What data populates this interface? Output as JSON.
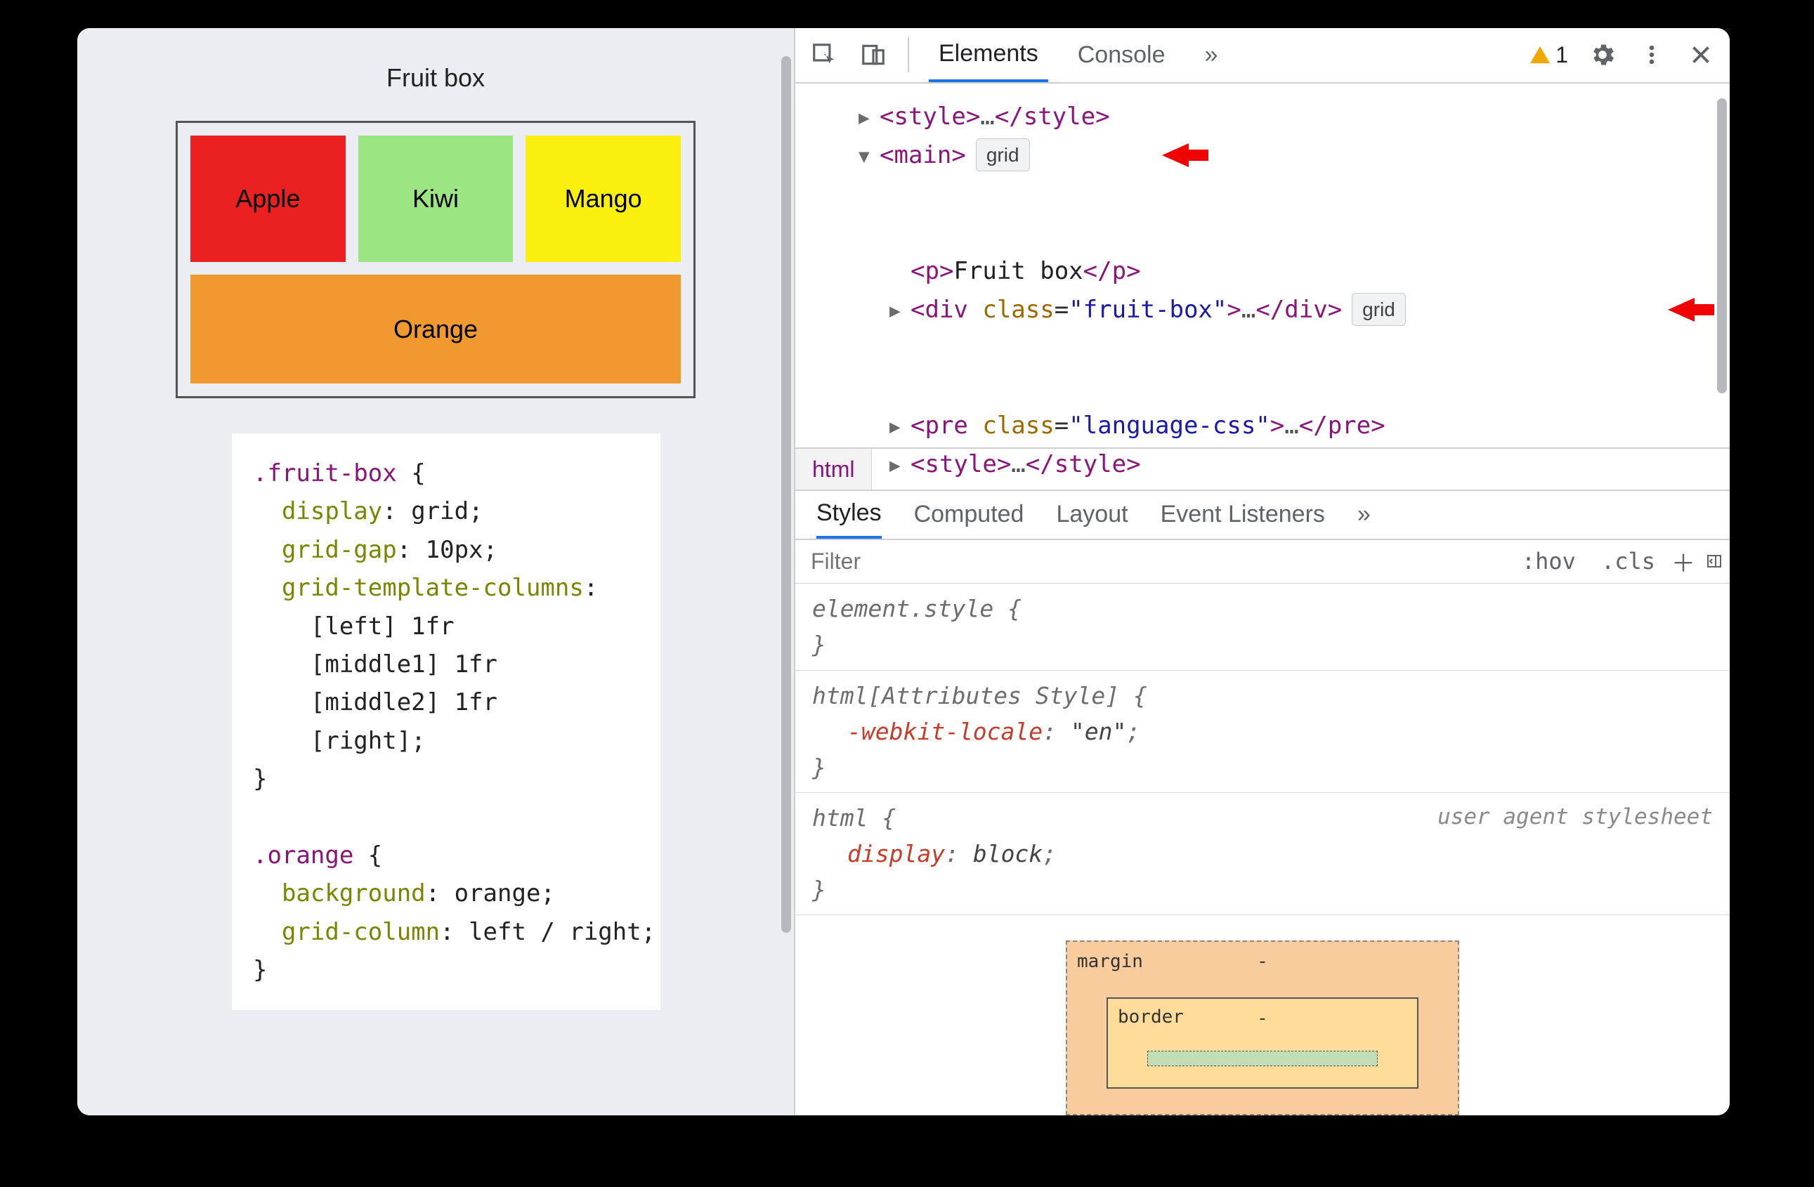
{
  "left": {
    "title": "Fruit box",
    "fruits": {
      "a": "Apple",
      "b": "Kiwi",
      "c": "Mango",
      "d": "Orange"
    },
    "code": {
      "sel1": ".fruit-box",
      "p1": "display",
      "v1": "grid",
      "p2": "grid-gap",
      "v2": "10px",
      "p3": "grid-template-columns",
      "v3a": "[left] 1fr",
      "v3b": "[middle1] 1fr",
      "v3c": "[middle2] 1fr",
      "v3d": "[right]",
      "sel2": ".orange",
      "p4": "background",
      "v4": "orange",
      "p5": "grid-column",
      "v5": "left / right"
    }
  },
  "devtools": {
    "tabs": {
      "elements": "Elements",
      "console": "Console",
      "more": "»"
    },
    "warning_count": "1",
    "dom": {
      "l1_open": "<style>",
      "l1_ell": "…",
      "l1_close": "</style>",
      "l2_open": "<main>",
      "l2_badge": "grid",
      "l3_open": "<p>",
      "l3_text": "Fruit box",
      "l3_close": "</p>",
      "l4_open_a": "<div ",
      "l4_attr_n": "class",
      "l4_attr_v": "\"fruit-box\"",
      "l4_open_b": ">",
      "l4_ell": "…",
      "l4_close": "</div>",
      "l4_badge": "grid",
      "l5_open_a": "<pre ",
      "l5_attr_n": "class",
      "l5_attr_v": "\"language-css\"",
      "l5_open_b": ">",
      "l5_ell": "…",
      "l5_close": "</pre>",
      "l6_open": "<style>",
      "l6_ell": "…",
      "l6_close": "</style>"
    },
    "breadcrumb": "html",
    "styles_tabs": {
      "styles": "Styles",
      "computed": "Computed",
      "layout": "Layout",
      "listeners": "Event Listeners",
      "more": "»"
    },
    "filter": {
      "placeholder": "Filter",
      "hov": ":hov",
      "cls": ".cls"
    },
    "rules": {
      "r1_sel": "element.style {",
      "r1_close": "}",
      "r2_sel": "html[Attributes Style] {",
      "r2_prop": "-webkit-locale",
      "r2_val": "\"en\"",
      "r2_close": "}",
      "r3_sel": "html {",
      "r3_origin": "user agent stylesheet",
      "r3_prop": "display",
      "r3_val": "block",
      "r3_close": "}"
    },
    "boxmodel": {
      "margin": "margin",
      "margin_val": "-",
      "border": "border",
      "border_val": "-"
    }
  }
}
